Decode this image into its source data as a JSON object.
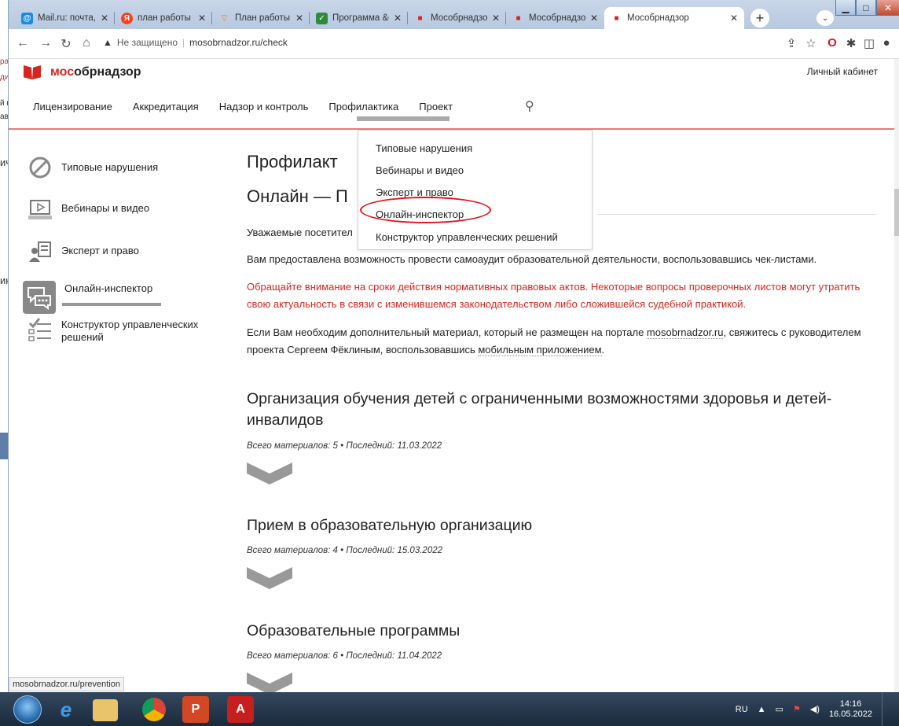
{
  "bg_window": {
    "fragments": [
      "ра",
      "ди",
      "он",
      "й н",
      "ав",
      "ич",
      "ик"
    ]
  },
  "tabs": [
    {
      "title": "Mail.ru: почта, п",
      "favicon_color": "#168de2",
      "favicon_glyph": "@"
    },
    {
      "title": "план работы с п",
      "favicon_color": "#fc3f1d",
      "favicon_glyph": "Я"
    },
    {
      "title": "План работы с",
      "favicon_color": "#f27b2a",
      "favicon_glyph": "▽"
    },
    {
      "title": "Программа &ф",
      "favicon_color": "#2e8b3c",
      "favicon_glyph": "✓"
    },
    {
      "title": "Мособрнадзор",
      "favicon_color": "#d8251f",
      "favicon_glyph": "■"
    },
    {
      "title": "Мособрнадзор",
      "favicon_color": "#d8251f",
      "favicon_glyph": "■"
    },
    {
      "title": "Мособрнадзор",
      "favicon_color": "#d8251f",
      "favicon_glyph": "■",
      "active": true
    }
  ],
  "toolbar": {
    "insecure": "Не защищено",
    "url": "mosobrnadzor.ru/check"
  },
  "site": {
    "brand_prefix": "мос",
    "brand_rest": "обрнадзор",
    "brand_color": "#d8251f",
    "cabinet": "Личный кабинет",
    "nav": [
      "Лицензирование",
      "Аккредитация",
      "Надзор и контроль",
      "Профилактика",
      "Проект"
    ]
  },
  "sidebar": [
    {
      "label": "Типовые нарушения",
      "icon": "prohibited-icon"
    },
    {
      "label": "Вебинары и видео",
      "icon": "video-icon"
    },
    {
      "label": "Эксперт и право",
      "icon": "expert-icon"
    },
    {
      "label": "Онлайн-инспектор",
      "icon": "chat-icon",
      "active": true
    },
    {
      "label": "Конструктор управленческих решений",
      "icon": "checklist-icon"
    }
  ],
  "content": {
    "title": "Профилакт",
    "subtitle": "Онлайн — П",
    "greeting": "Уважаемые посетител",
    "p1": "Вам предоставлена возможность провести самоаудит образовательной деятельности, воспользовавшись чек-листами.",
    "p2": "Обращайте внимание на сроки действия нормативных правовых актов. Некоторые вопросы проверочных листов могут утратить свою актуальность в связи с изменившемся законодательством либо сложившейся судебной практикой.",
    "p3_before": "Если Вам необходим дополнительный материал, который не размещен на портале ",
    "p3_link1": "mosobrnadzor.ru",
    "p3_mid": ", свяжитесь с руководителем проекта Сергеем Фёклиным, воспользовавшись ",
    "p3_link2": "мобильным приложением",
    "p3_after": ".",
    "sections": [
      {
        "title": "Организация обучения детей с ограниченными возможностями здоровья и детей-инвалидов",
        "meta": "Всего материалов: 5 • Последний: 11.03.2022"
      },
      {
        "title": "Прием в образовательную организацию",
        "meta": "Всего материалов: 4 • Последний: 15.03.2022"
      },
      {
        "title": "Образовательные программы",
        "meta": "Всего материалов: 6 • Последний: 11.04.2022"
      }
    ]
  },
  "dropdown": [
    "Типовые нарушения",
    "Вебинары и видео",
    "Эксперт и право",
    "Онлайн-инспектор",
    "Конструктор управленческих решений"
  ],
  "status_url": "mosobrnadzor.ru/prevention",
  "tray": {
    "lang": "RU",
    "time": "14:16",
    "date": "16.05.2022"
  }
}
